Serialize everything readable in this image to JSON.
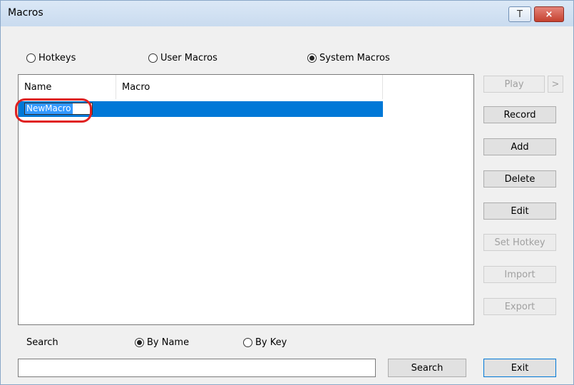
{
  "window": {
    "title": "Macros",
    "pin_glyph": "T",
    "close_glyph": "×"
  },
  "mode_options": [
    {
      "label": "Hotkeys",
      "selected": false
    },
    {
      "label": "User Macros",
      "selected": false
    },
    {
      "label": "System Macros",
      "selected": true
    }
  ],
  "table": {
    "columns": [
      "Name",
      "Macro"
    ],
    "rows": [
      {
        "name": "NewMacro",
        "macro": "",
        "selected": true,
        "editing": true
      }
    ]
  },
  "buttons": {
    "play": "Play",
    "play_more": ">",
    "record": "Record",
    "add": "Add",
    "delete": "Delete",
    "edit": "Edit",
    "set_hotkey": "Set Hotkey",
    "import": "Import",
    "export": "Export",
    "exit": "Exit"
  },
  "search": {
    "label": "Search",
    "options": [
      {
        "label": "By Name",
        "selected": true
      },
      {
        "label": "By Key",
        "selected": false
      }
    ],
    "value": "",
    "button": "Search"
  },
  "colors": {
    "selection": "#0078d7",
    "callout": "#e02020"
  }
}
